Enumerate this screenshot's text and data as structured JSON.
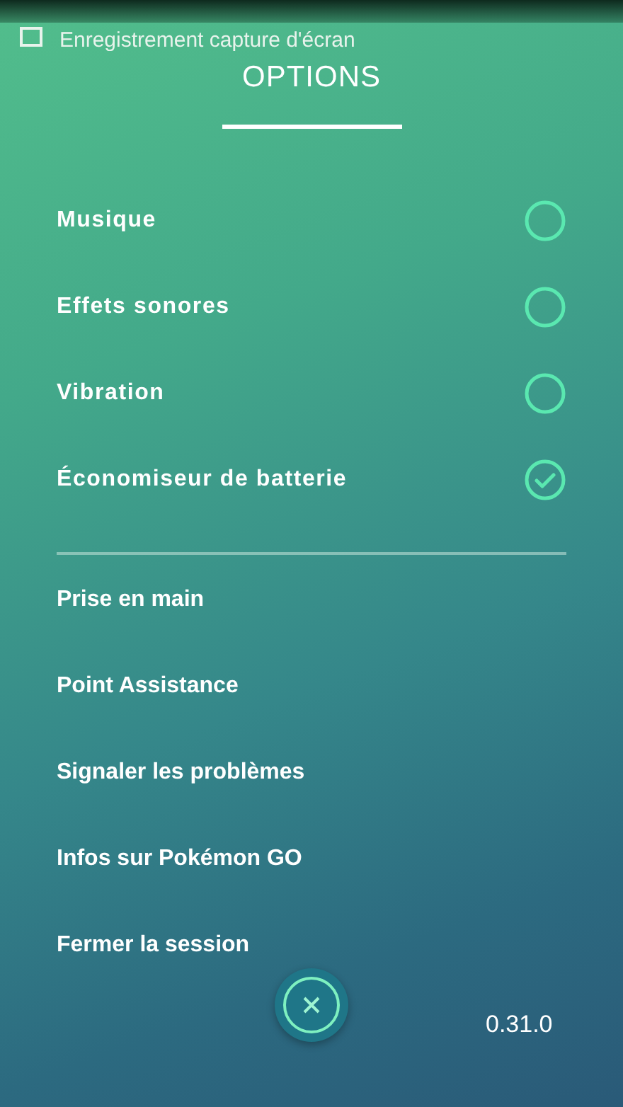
{
  "notification": {
    "text": "Enregistrement capture d'écran"
  },
  "title": "OPTIONS",
  "toggles": [
    {
      "label": "Musique",
      "checked": false
    },
    {
      "label": "Effets sonores",
      "checked": false
    },
    {
      "label": "Vibration",
      "checked": false
    },
    {
      "label": "Économiseur de batterie",
      "checked": true
    }
  ],
  "links": [
    "Prise en main",
    "Point Assistance",
    "Signaler les problèmes",
    "Infos sur Pokémon GO",
    "Fermer la session"
  ],
  "version": "0.31.0"
}
